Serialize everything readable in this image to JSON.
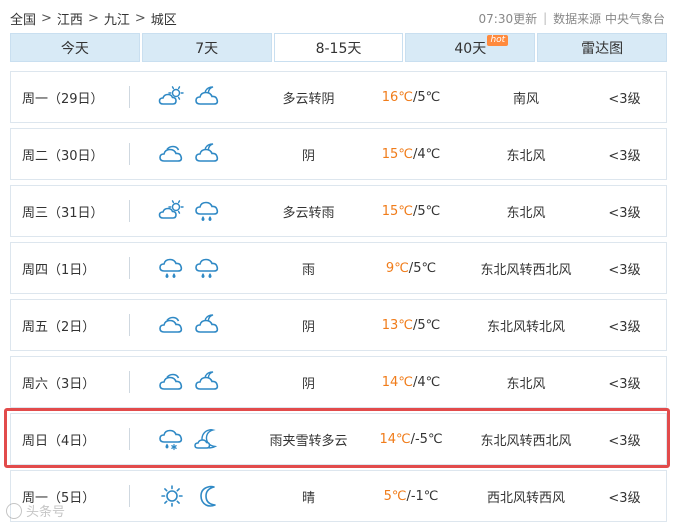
{
  "breadcrumb": {
    "items": [
      "全国",
      "江西",
      "九江",
      "城区"
    ],
    "separator": ">"
  },
  "source": {
    "updated": "07:30更新",
    "divider": "|",
    "data_source": "数据来源 中央气象台"
  },
  "tabs": [
    {
      "label": "今天",
      "active": false
    },
    {
      "label": "7天",
      "active": false
    },
    {
      "label": "8-15天",
      "active": true
    },
    {
      "label": "40天",
      "active": false,
      "badge": "hot"
    },
    {
      "label": "雷达图",
      "active": false
    }
  ],
  "colors": {
    "accent_tab": "#d8eaf6",
    "high_temp": "#f07c1a",
    "highlight": "#e24b4b",
    "icon": "#2f89c5"
  },
  "forecast": [
    {
      "date": "周一（29日）",
      "icons": [
        "partly-cloudy-day-icon",
        "cloudy-night-icon"
      ],
      "desc": "多云转阴",
      "hi": "16℃",
      "lo": "5℃",
      "wind": "南风",
      "level": "<3级"
    },
    {
      "date": "周二（30日）",
      "icons": [
        "overcast-icon",
        "cloudy-night-icon"
      ],
      "desc": "阴",
      "hi": "15℃",
      "lo": "4℃",
      "wind": "东北风",
      "level": "<3级"
    },
    {
      "date": "周三（31日）",
      "icons": [
        "partly-cloudy-day-icon",
        "rain-icon"
      ],
      "desc": "多云转雨",
      "hi": "15℃",
      "lo": "5℃",
      "wind": "东北风",
      "level": "<3级"
    },
    {
      "date": "周四（1日）",
      "icons": [
        "rain-icon",
        "rain-icon"
      ],
      "desc": "雨",
      "hi": "9℃",
      "lo": "5℃",
      "wind": "东北风转西北风",
      "level": "<3级"
    },
    {
      "date": "周五（2日）",
      "icons": [
        "overcast-icon",
        "cloudy-night-icon"
      ],
      "desc": "阴",
      "hi": "13℃",
      "lo": "5℃",
      "wind": "东北风转北风",
      "level": "<3级"
    },
    {
      "date": "周六（3日）",
      "icons": [
        "overcast-icon",
        "cloudy-night-icon"
      ],
      "desc": "阴",
      "hi": "14℃",
      "lo": "4℃",
      "wind": "东北风",
      "level": "<3级"
    },
    {
      "date": "周日（4日）",
      "icons": [
        "sleet-icon",
        "partly-cloudy-night-icon"
      ],
      "desc": "雨夹雪转多云",
      "hi": "14℃",
      "lo": "-5℃",
      "wind": "东北风转西北风",
      "level": "<3级"
    },
    {
      "date": "周一（5日）",
      "icons": [
        "sunny-icon",
        "clear-night-icon"
      ],
      "desc": "晴",
      "hi": "5℃",
      "lo": "-1℃",
      "wind": "西北风转西风",
      "level": "<3级"
    }
  ],
  "watermark": {
    "text": "头条号"
  }
}
